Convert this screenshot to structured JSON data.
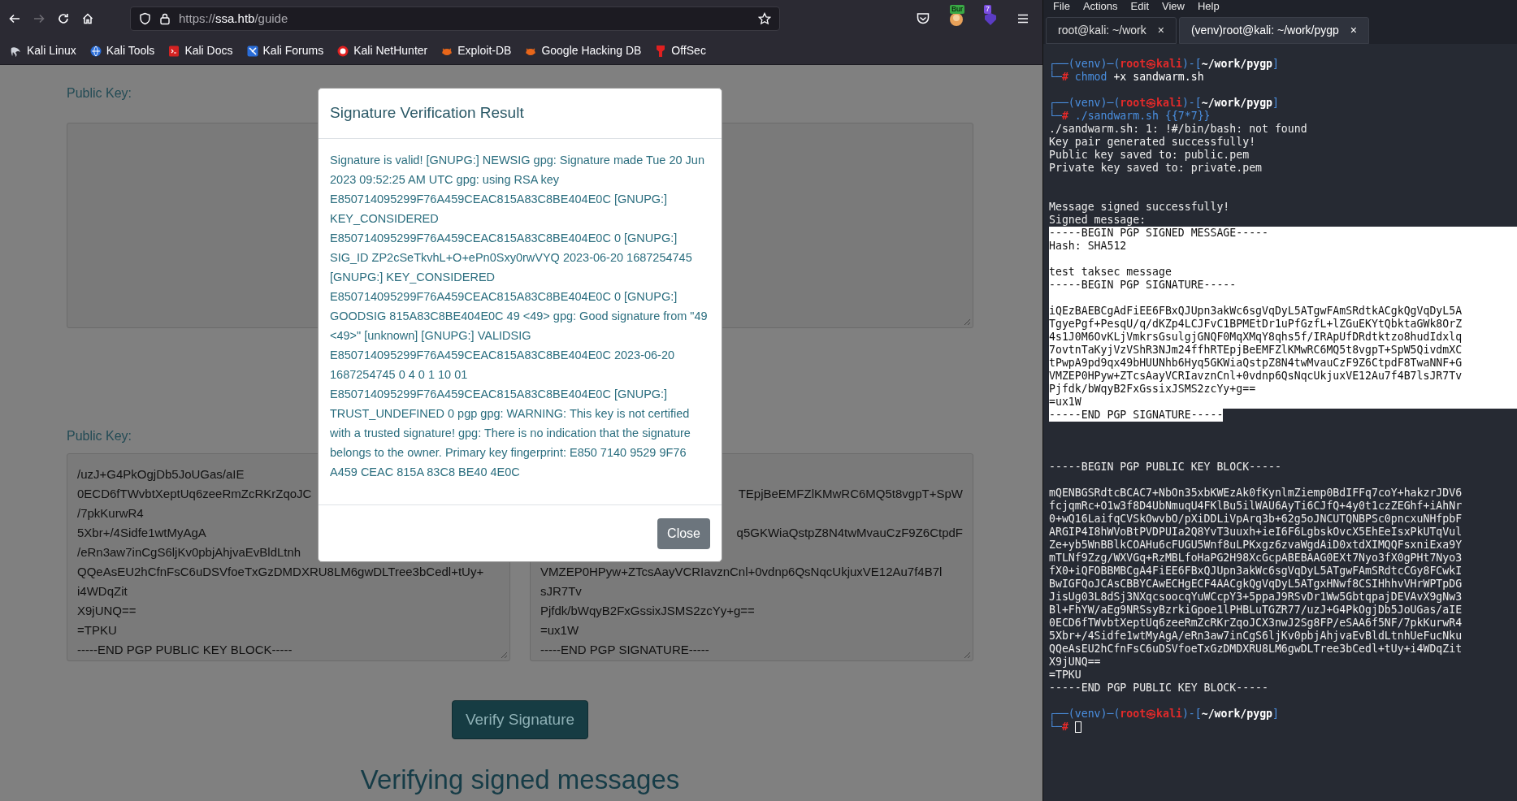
{
  "browser": {
    "forward_disabled": true,
    "url": {
      "scheme": "https://",
      "host": "ssa.htb",
      "path": "/guide"
    },
    "extensions": [
      {
        "kind": "pocket"
      },
      {
        "kind": "avatar",
        "badge": "Bur"
      },
      {
        "kind": "shield",
        "badge": "7"
      }
    ],
    "bookmarks": [
      {
        "label": "Kali Linux",
        "kind": "dragon"
      },
      {
        "label": "Kali Tools",
        "kind": "globe"
      },
      {
        "label": "Kali Docs",
        "kind": "doc"
      },
      {
        "label": "Kali Forums",
        "kind": "forum"
      },
      {
        "label": "Kali NetHunter",
        "kind": "ring"
      },
      {
        "label": "Exploit-DB",
        "kind": "bug"
      },
      {
        "label": "Google Hacking DB",
        "kind": "bug"
      },
      {
        "label": "OffSec",
        "kind": "figure"
      }
    ]
  },
  "page": {
    "sections": [
      {
        "label": "Public Key:"
      },
      {
        "label": "Public Key:",
        "left_lines": [
          {
            "kind": "full",
            "text": "/uzJ+G4PkOgjDb5JoUGas/aIE"
          },
          {
            "kind": "full",
            "text": "0ECD6fTWvbtXeptUq6zeeRmZcRKrZqoJC"
          },
          {
            "kind": "full",
            "text": "/7pkKurwR4"
          },
          {
            "kind": "full",
            "text": "5Xbr+/4Sidfe1wtMyAgA"
          },
          {
            "kind": "full",
            "text": "/eRn3aw7inCgS6ljKv0pbjAhjvaEvBldLtnh"
          },
          {
            "kind": "full",
            "text": "QQeAsEU2hCfnFsC6uDSVfoeTxGzDMDXRU8LM6gwDLTree3bCedl+tUy+"
          },
          {
            "kind": "full",
            "text": "i4WDqZit"
          },
          {
            "kind": "full",
            "text": "X9jUNQ=="
          },
          {
            "kind": "full",
            "text": "=TPKU"
          },
          {
            "kind": "full",
            "text": "-----END PGP PUBLIC KEY BLOCK-----"
          }
        ],
        "right_lines": [
          {
            "kind": "covered"
          },
          {
            "kind": "partial",
            "text": "TEpjBeEMFZlKMwRC6MQ5t8vgpT+SpW"
          },
          {
            "kind": "covered"
          },
          {
            "kind": "partial",
            "text": "q5GKWiaQstpZ8N4twMvauCzF9Z6CtpdF"
          },
          {
            "kind": "covered"
          },
          {
            "kind": "full",
            "text": "VMZEP0HPyw+ZTcsAayVCRIavznCnl+0vdnp6QsNqcUkjuxVE12Au7f4B7l"
          },
          {
            "kind": "full",
            "text": "sJR7Tv"
          },
          {
            "kind": "full",
            "text": "Pjfdk/bWqyB2FxGssixJSMS2zcYy+g=="
          },
          {
            "kind": "full",
            "text": "=ux1W"
          },
          {
            "kind": "full",
            "text": "-----END PGP SIGNATURE-----"
          }
        ]
      }
    ],
    "verify_button": "Verify Signature",
    "heading": "Verifying signed messages"
  },
  "modal": {
    "title": "Signature Verification Result",
    "body": "Signature is valid! [GNUPG:] NEWSIG gpg: Signature made Tue 20 Jun 2023 09:52:25 AM UTC gpg: using RSA key E850714095299F76A459CEAC815A83C8BE404E0C [GNUPG:] KEY_CONSIDERED E850714095299F76A459CEAC815A83C8BE404E0C 0 [GNUPG:] SIG_ID ZP2cSeTkvhL+O+ePn0Sxy0rwVYQ 2023-06-20 1687254745 [GNUPG:] KEY_CONSIDERED E850714095299F76A459CEAC815A83C8BE404E0C 0 [GNUPG:] GOODSIG 815A83C8BE404E0C 49 <49> gpg: Good signature from \"49 <49>\" [unknown] [GNUPG:] VALIDSIG E850714095299F76A459CEAC815A83C8BE404E0C 2023-06-20 1687254745 0 4 0 1 10 01 E850714095299F76A459CEAC815A83C8BE404E0C [GNUPG:] TRUST_UNDEFINED 0 pgp gpg: WARNING: This key is not certified with a trusted signature! gpg: There is no indication that the signature belongs to the owner. Primary key fingerprint: E850 7140 9529 9F76 A459 CEAC 815A 83C8 BE40 4E0C",
    "close_button": "Close"
  },
  "terminal": {
    "menu": [
      "File",
      "Actions",
      "Edit",
      "View",
      "Help"
    ],
    "tabs": [
      {
        "label": "root@kali: ~/work",
        "close": "×",
        "selected": false
      },
      {
        "label": "(venv)root@kali: ~/work/pygp",
        "close": "×",
        "selected": true
      }
    ],
    "cursor": true,
    "lines": [
      {
        "kind": "prompt_head",
        "highlighted": false,
        "parts": [
          "┌──(venv)─(",
          "root㉿kali",
          ")-[",
          "~/work/pygp",
          "]"
        ]
      },
      {
        "kind": "prompt_input",
        "highlighted": false,
        "parts": [
          "└─",
          "#",
          " chmod",
          " +x sandwarm.sh"
        ]
      },
      {
        "kind": "blank",
        "highlighted": false
      },
      {
        "kind": "prompt_head",
        "highlighted": false,
        "parts": [
          "┌──(venv)─(",
          "root㉿kali",
          ")-[",
          "~/work/pygp",
          "]"
        ]
      },
      {
        "kind": "prompt_input",
        "highlighted": false,
        "parts": [
          "└─",
          "#",
          " ./sandwarm.sh {{7*7}}"
        ]
      },
      {
        "kind": "output",
        "highlighted": false,
        "text": "./sandwarm.sh: 1: !#/bin/bash: not found"
      },
      {
        "kind": "output",
        "highlighted": false,
        "text": "Key pair generated successfully!"
      },
      {
        "kind": "output",
        "highlighted": false,
        "text": "Public key saved to: public.pem"
      },
      {
        "kind": "output",
        "highlighted": false,
        "text": "Private key saved to: private.pem"
      },
      {
        "kind": "blank",
        "highlighted": false
      },
      {
        "kind": "blank",
        "highlighted": false
      },
      {
        "kind": "output",
        "highlighted": false,
        "text": "Message signed successfully!"
      },
      {
        "kind": "output",
        "highlighted": false,
        "text": "Signed message:"
      },
      {
        "kind": "output",
        "highlighted": true,
        "text": "-----BEGIN PGP SIGNED MESSAGE-----"
      },
      {
        "kind": "output",
        "highlighted": true,
        "text": "Hash: SHA512"
      },
      {
        "kind": "blank",
        "highlighted": true
      },
      {
        "kind": "output",
        "highlighted": true,
        "text": "test taksec message"
      },
      {
        "kind": "output",
        "highlighted": true,
        "text": "-----BEGIN PGP SIGNATURE-----"
      },
      {
        "kind": "blank",
        "highlighted": true
      },
      {
        "kind": "output",
        "highlighted": true,
        "text": "iQEzBAEBCgAdFiEE6FBxQJUpn3akWc6sgVqDyL5ATgwFAmSRdtkACgkQgVqDyL5A"
      },
      {
        "kind": "output",
        "highlighted": true,
        "text": "TgyePgf+PesqU/q/dKZp4LCJFvC1BPMEtDr1uPfGzfL+lZGuEKYtQbktaGWk8OrZ"
      },
      {
        "kind": "output",
        "highlighted": true,
        "text": "4s1J0M6OvKLjVmkrsGsulgjGNQF0MqXMqY8qhs5f/IRApUfDRdtktzo8hudIdxlq"
      },
      {
        "kind": "output",
        "highlighted": true,
        "text": "7ovtnTaKyjVzVShR3NJm24ffhRTEpjBeEMFZlKMwRC6MQ5t8vgpT+SpW5QivdmXC"
      },
      {
        "kind": "output",
        "highlighted": true,
        "text": "tPwpA9pd9qx49bHUUNhb6Hyq5GKWiaQstpZ8N4twMvauCzF9Z6CtpdF8TwaNNF+G"
      },
      {
        "kind": "output",
        "highlighted": true,
        "text": "VMZEP0HPyw+ZTcsAayVCRIavznCnl+0vdnp6QsNqcUkjuxVE12Au7f4B7lsJR7Tv"
      },
      {
        "kind": "output",
        "highlighted": true,
        "text": "Pjfdk/bWqyB2FxGssixJSMS2zcYy+g=="
      },
      {
        "kind": "output",
        "highlighted": true,
        "text": "=ux1W"
      },
      {
        "kind": "output",
        "highlighted": true,
        "text": "-----END PGP SIGNATURE-----"
      },
      {
        "kind": "blank",
        "highlighted": false
      },
      {
        "kind": "blank",
        "highlighted": false
      },
      {
        "kind": "blank",
        "highlighted": false
      },
      {
        "kind": "output",
        "highlighted": false,
        "text": "-----BEGIN PGP PUBLIC KEY BLOCK-----"
      },
      {
        "kind": "blank",
        "highlighted": false
      },
      {
        "kind": "output",
        "highlighted": false,
        "text": "mQENBGSRdtcBCAC7+NbOn35xbKWEzAk0fKynlmZiemp0BdIFFq7coY+hakzrJDV6"
      },
      {
        "kind": "output",
        "highlighted": false,
        "text": "fcjqmRc+O1w3f8D4UbNmuqU4FKlBu5ilWAU6AyTi6CJfQ+4y0t1czZEGhf+iAhNr"
      },
      {
        "kind": "output",
        "highlighted": false,
        "text": "0+wQ16LaifqCVSkOwvbO/pXiDDLiVpArq3b+62g5oJNCUTQNBPSc0pncxuNHfpbF"
      },
      {
        "kind": "output",
        "highlighted": false,
        "text": "ARGIP4I8hWVoBtPVDPUIa2Q8YvT3uuxh+ieI6F6LgbskOvcX5EhEeIsxPkUTqVul"
      },
      {
        "kind": "output",
        "highlighted": false,
        "text": "Ze+yb5WnBBlkCOAHu6cFUGU5Wnf8uLPKxgz6zvaWgdAiD0xtdXIMQQFsxniExa9Y"
      },
      {
        "kind": "output",
        "highlighted": false,
        "text": "mTLNf9Zzg/WXVGq+RzMBLfoHaPG2H98XcGcpABEBAAG0EXt7Nyo3fX0gPHt7Nyo3"
      },
      {
        "kind": "output",
        "highlighted": false,
        "text": "fX0+iQFOBBMBCgA4FiEE6FBxQJUpn3akWc6sgVqDyL5ATgwFAmSRdtcCGy8FCwkI"
      },
      {
        "kind": "output",
        "highlighted": false,
        "text": "BwIGFQoJCAsCBBYCAwECHgECF4AACgkQgVqDyL5ATgxHNwf8CSIHhhvVHrWPTpDG"
      },
      {
        "kind": "output",
        "highlighted": false,
        "text": "JisUg03L8dSj3NXqcsoocqYuWCcpY3+5ppaJ9RSvDr1Ww5GbtqpajDEVAvX9gNw3"
      },
      {
        "kind": "output",
        "highlighted": false,
        "text": "Bl+FhYW/aEg9NRSsyBzrkiGpoe1lPHBLuTGZR77/uzJ+G4PkOgjDb5JoUGas/aIE"
      },
      {
        "kind": "output",
        "highlighted": false,
        "text": "0ECD6fTWvbtXeptUq6zeeRmZcRKrZqoJCX3nwJ2Sg8FP/eSAA6f5NF/7pkKurwR4"
      },
      {
        "kind": "output",
        "highlighted": false,
        "text": "5Xbr+/4Sidfe1wtMyAgA/eRn3aw7inCgS6ljKv0pbjAhjvaEvBldLtnhUeFucNku"
      },
      {
        "kind": "output",
        "highlighted": false,
        "text": "QQeAsEU2hCfnFsC6uDSVfoeTxGzDMDXRU8LM6gwDLTree3bCedl+tUy+i4WDqZit"
      },
      {
        "kind": "output",
        "highlighted": false,
        "text": "X9jUNQ=="
      },
      {
        "kind": "output",
        "highlighted": false,
        "text": "=TPKU"
      },
      {
        "kind": "output",
        "highlighted": false,
        "text": "-----END PGP PUBLIC KEY BLOCK-----"
      },
      {
        "kind": "blank",
        "highlighted": false
      },
      {
        "kind": "prompt_head",
        "highlighted": false,
        "parts": [
          "┌──(venv)─(",
          "root㉿kali",
          ")-[",
          "~/work/pygp",
          "]"
        ]
      },
      {
        "kind": "prompt_input",
        "highlighted": false,
        "parts": [
          "└─",
          "#"
        ]
      }
    ]
  }
}
